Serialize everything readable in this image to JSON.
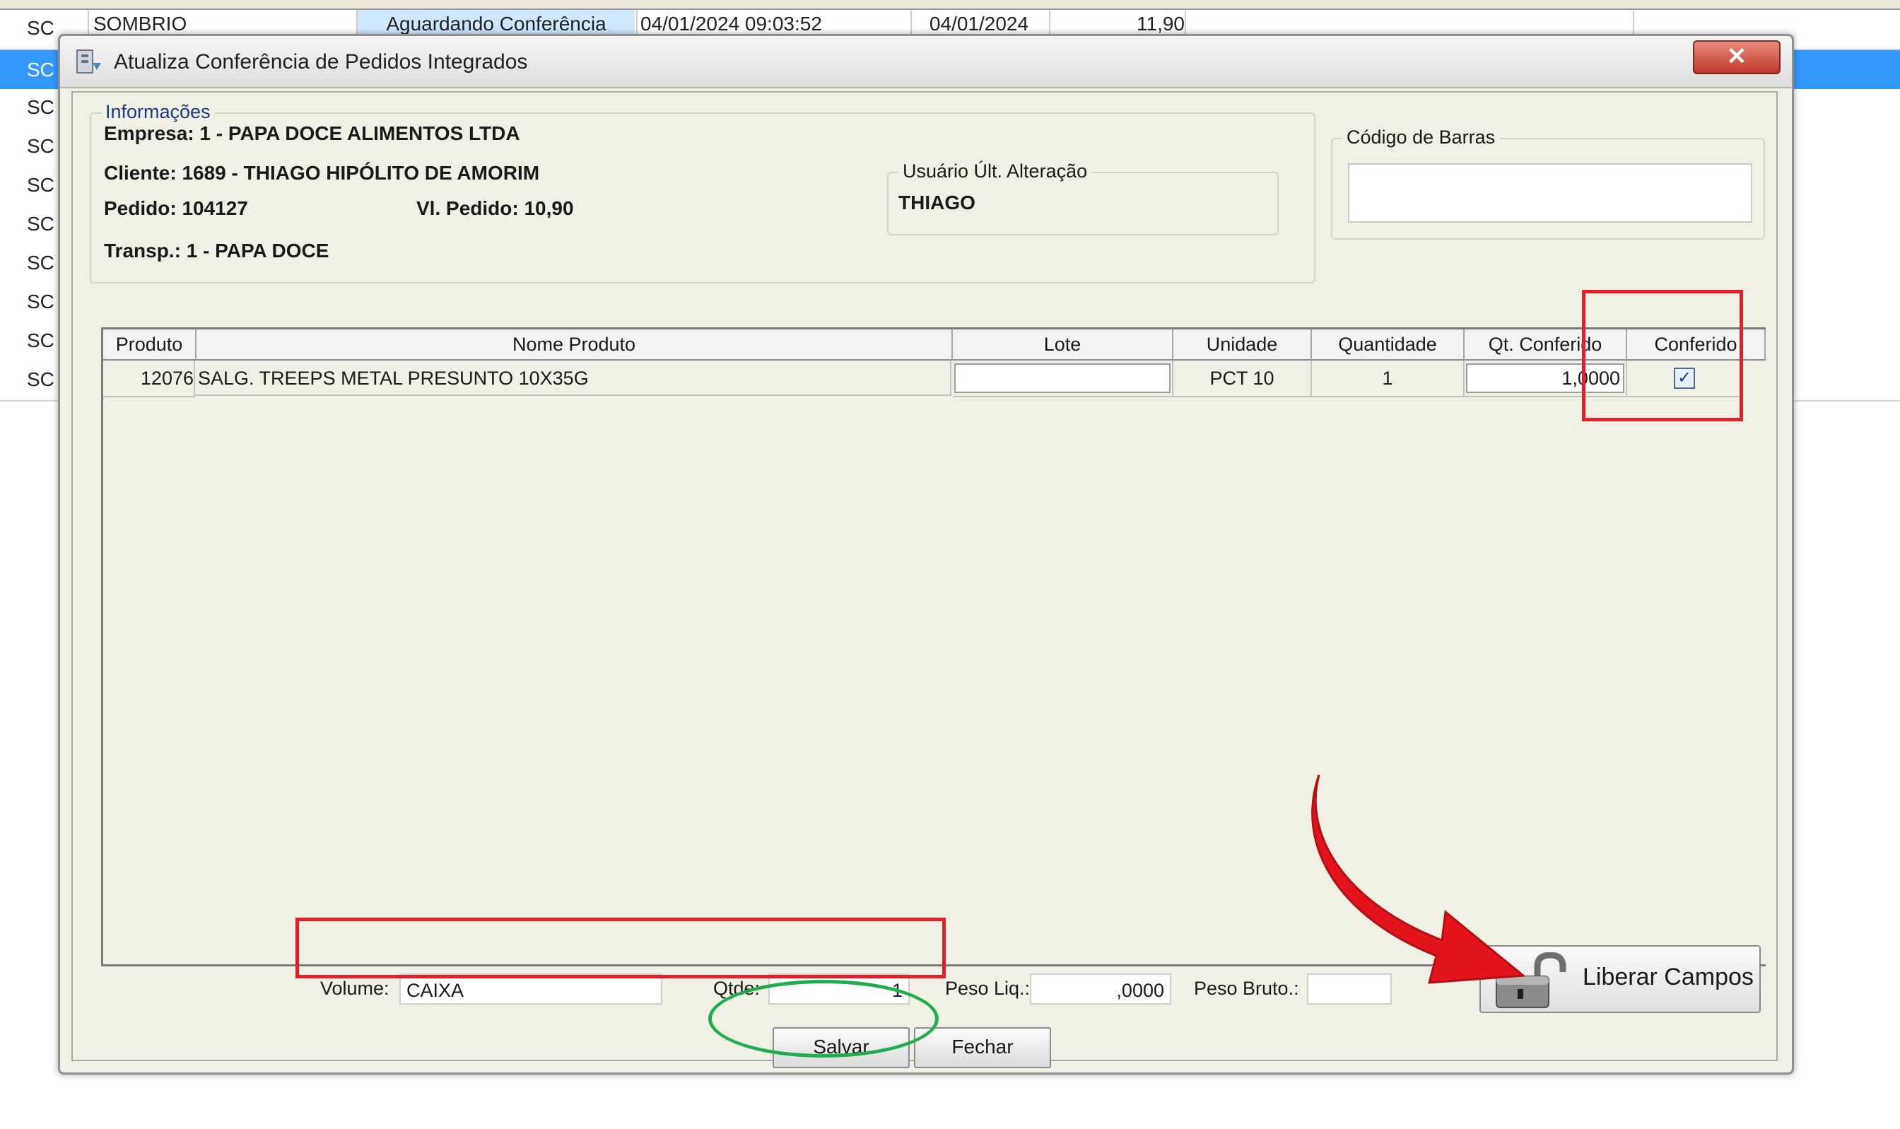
{
  "background": {
    "first_row": {
      "state": "SC",
      "city": "SOMBRIO",
      "status": "Aguardando Conferência",
      "conference_datetime": "04/01/2024 09:03:52",
      "issue_date": "04/01/2024",
      "order_value": "11,90"
    },
    "row_states": [
      "SC",
      "SC",
      "SC",
      "SC",
      "SC",
      "SC",
      "SC",
      "SC",
      "SC",
      "SC"
    ]
  },
  "dialog": {
    "title": "Atualiza Conferência de Pedidos Integrados",
    "close_glyph": "✕",
    "info": {
      "group_title": "Informações",
      "empresa": "Empresa: 1 - PAPA DOCE ALIMENTOS LTDA",
      "cliente": "Cliente: 1689 - THIAGO HIPÓLITO DE AMORIM",
      "pedido": "Pedido: 104127",
      "vl_pedido": "Vl. Pedido: 10,90",
      "transp": "Transp.: 1 - PAPA DOCE",
      "usuario_title": "Usuário Últ. Alteração",
      "usuario": "THIAGO"
    },
    "barcode": {
      "group_title": "Código de Barras",
      "value": ""
    },
    "table": {
      "columns": [
        "Produto",
        "Nome Produto",
        "Lote",
        "Unidade",
        "Quantidade",
        "Qt. Conferido",
        "Conferido"
      ],
      "rows": [
        {
          "produto": "12076",
          "nome": "SALG. TREEPS METAL PRESUNTO 10X35G",
          "lote": "",
          "unidade": "PCT 10",
          "quantidade": "1",
          "qt_conferido": "1,0000",
          "conferido": "✓"
        }
      ]
    },
    "footer": {
      "volume_label": "Volume:",
      "volume_value": "CAIXA",
      "qtde_label": "Qtde:",
      "qtde_value": "1",
      "peso_liq_label": "Peso Liq.:",
      "peso_liq_value": ",0000",
      "peso_bruto_label": "Peso Bruto.:",
      "peso_bruto_value": "",
      "save_label": "Salvar",
      "close_label": "Fechar",
      "liberar_label": "Liberar Campos"
    }
  },
  "colors": {
    "selection": "#3399ff",
    "annotation_red": "#e0212b",
    "annotation_green": "#1fae4b"
  }
}
